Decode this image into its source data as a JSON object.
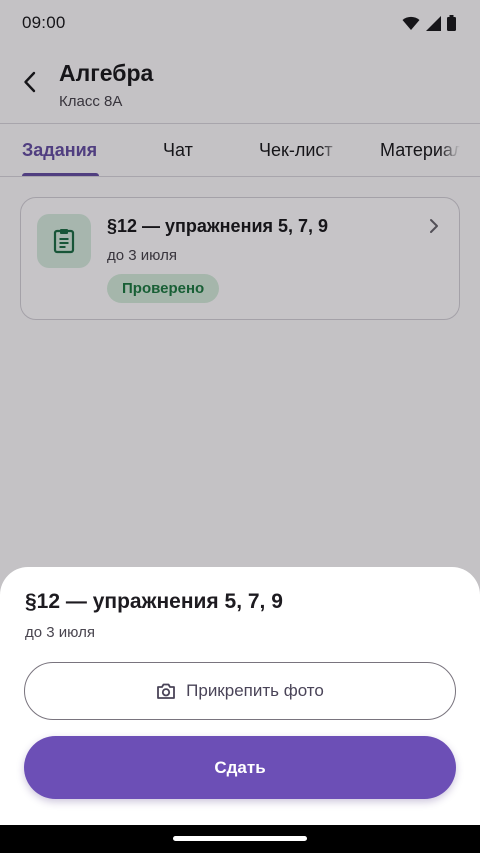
{
  "status_bar": {
    "time": "09:00"
  },
  "app_bar": {
    "title": "Алгебра",
    "subtitle": "Класс 8А"
  },
  "tabs": [
    {
      "label": "Задания",
      "active": true
    },
    {
      "label": "Чат",
      "active": false
    },
    {
      "label": "Чек-лист",
      "active": false
    },
    {
      "label": "Материалы",
      "active": false
    }
  ],
  "task": {
    "title": "§12 — упражнения 5, 7, 9",
    "due": "до 3 июля",
    "status": "Проверено",
    "icon": "clipboard-icon"
  },
  "sheet": {
    "title": "§12 — упражнения 5, 7, 9",
    "due": "до 3 июля",
    "attach_label": "Прикрепить фото",
    "submit_label": "Сдать"
  },
  "colors": {
    "accent": "#6c4fb6",
    "success": "#1f7a45",
    "success_bg": "#d4eadc"
  }
}
